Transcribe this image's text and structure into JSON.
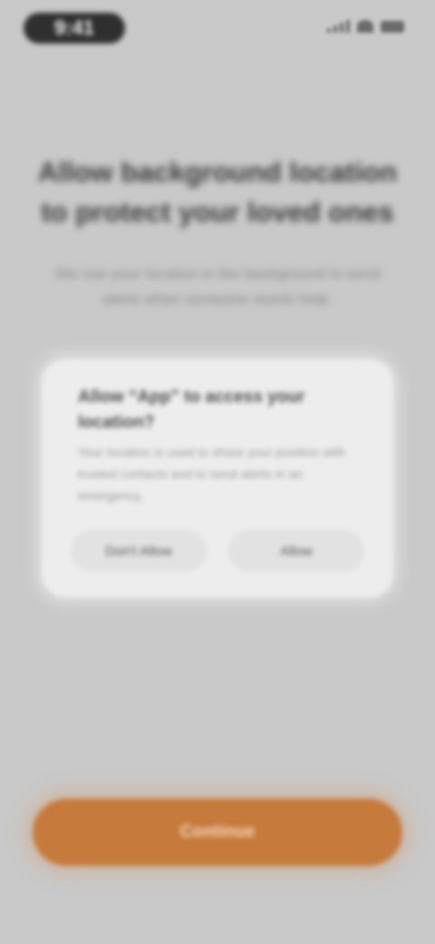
{
  "status_bar": {
    "time": "9:41"
  },
  "headline": "Allow background location to protect your loved ones",
  "subtext": "We use your location in the background to send alerts when someone needs help.",
  "dialog": {
    "title": "Allow “App” to access your location?",
    "body": "Your location is used to share your position with trusted contacts and to send alerts in an emergency.",
    "buttons": {
      "left": "Don't Allow",
      "right": "Allow"
    }
  },
  "primary_button": {
    "label": "Continue"
  },
  "colors": {
    "background": "#c9c9c9",
    "accent": "#c67a3b"
  }
}
